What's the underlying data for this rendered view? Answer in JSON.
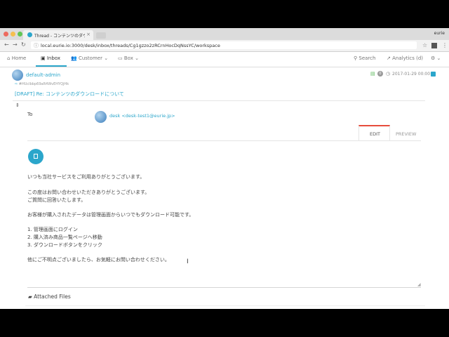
{
  "browser": {
    "tab_title": "Thread - コンテンツのダウンロ",
    "tab_close": "×",
    "profile": "eurie",
    "url": "local.eurie.io:3000/desk/inbox/threads/Cg1gzzo2zRCrnHocDqNssYC/workspace"
  },
  "nav": {
    "home": "Home",
    "inbox": "Inbox",
    "customer": "Customer",
    "box": "Box",
    "search": "Search",
    "analytics": "Analytics (d)"
  },
  "message": {
    "sender": "default-admin",
    "thread_id": "#HUcIbbp69aR4WvEHYQjHk",
    "subject": "[DRAFT] Re: コンテンツのダウンロードについて",
    "count": "0",
    "timestamp": "2017-01-29 00:00",
    "to_label": "To",
    "recipient": "desk <desk-test1@eurie.jp>"
  },
  "editor": {
    "tab_edit": "EDIT",
    "tab_preview": "PREVIEW",
    "lines": [
      "いつも当社サービスをご利用ありがとうございます。",
      "この度はお問い合わせいただきありがとうございます。",
      "ご質問に回答いたします。",
      "お客様が購入されたデータは管理画面からいつでもダウンロード可能です。",
      "1. 管理画面にログイン",
      "2. 購入済み商品一覧ページへ移動",
      "3. ダウンロードボタンをクリック",
      "他にご不明点ございましたら、お気軽にお問い合わせください。"
    ]
  },
  "attachments": {
    "label": "Attached Files"
  },
  "colors": {
    "accent": "#2ba6cb",
    "active_tab_border": "#e74c3c",
    "green_badge": "#5cb85c"
  }
}
